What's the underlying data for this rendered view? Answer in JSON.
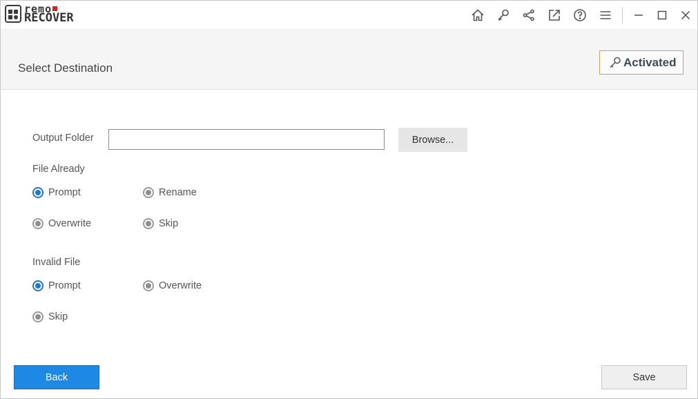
{
  "app": {
    "logo_line1": "remo",
    "logo_line2": "RECOVER"
  },
  "titlebar": {
    "icons": [
      "home-icon",
      "key-icon",
      "share-icon",
      "external-link-icon",
      "help-icon",
      "menu-icon"
    ],
    "window_controls": [
      "minimize-icon",
      "maximize-icon",
      "close-icon"
    ]
  },
  "header": {
    "title": "Select Destination",
    "activated_label": "Activated",
    "activated_border_color": "#c9a25e"
  },
  "output": {
    "label": "Output Folder",
    "value": "",
    "browse_label": "Browse..."
  },
  "file_already": {
    "label": "File Already",
    "options": [
      {
        "label": "Prompt",
        "checked": true
      },
      {
        "label": "Rename",
        "checked": false
      },
      {
        "label": "Overwrite",
        "checked": false
      },
      {
        "label": "Skip",
        "checked": false
      }
    ]
  },
  "invalid_file": {
    "label": "Invalid File",
    "options": [
      {
        "label": "Prompt",
        "checked": true
      },
      {
        "label": "Overwrite",
        "checked": false
      },
      {
        "label": "Skip",
        "checked": false
      }
    ]
  },
  "footer": {
    "back_label": "Back",
    "save_label": "Save"
  },
  "colors": {
    "accent": "#1e88e5",
    "radio_checked": "#1a78d6"
  }
}
